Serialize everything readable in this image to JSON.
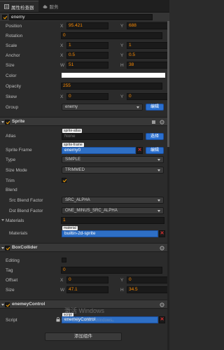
{
  "tabs": [
    {
      "label": "属性检查器",
      "active": true
    },
    {
      "label": "服务",
      "active": false
    }
  ],
  "node": {
    "active": true,
    "name": "enemy"
  },
  "node_props": {
    "position": {
      "label": "Position",
      "x": "95.421",
      "y": "688"
    },
    "rotation": {
      "label": "Rotation",
      "value": "0"
    },
    "scale": {
      "label": "Scale",
      "x": "1",
      "y": "1"
    },
    "anchor": {
      "label": "Anchor",
      "x": "0.5",
      "y": "0.5"
    },
    "size": {
      "label": "Size",
      "w": "51",
      "h": "38"
    },
    "color": {
      "label": "Color",
      "value": "#ffffff"
    },
    "opacity": {
      "label": "Opacity",
      "value": "255"
    },
    "skew": {
      "label": "Skew",
      "x": "0",
      "y": "0"
    },
    "group": {
      "label": "Group",
      "value": "enemy",
      "edit_label": "编辑"
    }
  },
  "axis": {
    "x": "X",
    "y": "Y",
    "w": "W",
    "h": "H"
  },
  "sprite": {
    "title": "Sprite",
    "enabled": true,
    "atlas": {
      "label": "Atlas",
      "tag": "sprite-atlas",
      "value": "None",
      "select_label": "选择"
    },
    "sprite_frame": {
      "label": "Sprite Frame",
      "tag": "sprite-frame",
      "value": "enemy0",
      "edit_label": "编辑"
    },
    "type": {
      "label": "Type",
      "value": "SIMPLE"
    },
    "size_mode": {
      "label": "Size Mode",
      "value": "TRIMMED"
    },
    "trim": {
      "label": "Trim",
      "checked": true
    },
    "blend": {
      "label": "Blend"
    },
    "src_blend": {
      "label": "Src Blend Factor",
      "value": "SRC_ALPHA"
    },
    "dst_blend": {
      "label": "Dst Blend Factor",
      "value": "ONE_MINUS_SRC_ALPHA"
    },
    "materials_count": {
      "label": "Materials",
      "value": "1"
    },
    "materials": {
      "label": "Materials",
      "tag": "material",
      "value": "builtin-2d-sprite"
    }
  },
  "box_collider": {
    "title": "BoxCollider",
    "enabled": true,
    "editing": {
      "label": "Editing",
      "checked": false
    },
    "tag": {
      "label": "Tag",
      "value": "0"
    },
    "offset": {
      "label": "Offset",
      "x": "0",
      "y": "0"
    },
    "size": {
      "label": "Size",
      "w": "47.1",
      "h": "34.5"
    }
  },
  "enemy_control": {
    "title": "enemeyControl",
    "enabled": true,
    "script": {
      "label": "Script",
      "tag": "script",
      "value": "enemeyControl"
    }
  },
  "add_component_label": "添加组件",
  "watermark": {
    "line1": "激活 Windows",
    "line2": "转到\"设置\"以激活 Windows。"
  },
  "colors": {
    "accent": "#ff8c00",
    "asset_blue": "#2e6fc5",
    "button_blue": "#2a6fcf",
    "delete_red": "#e03030"
  }
}
